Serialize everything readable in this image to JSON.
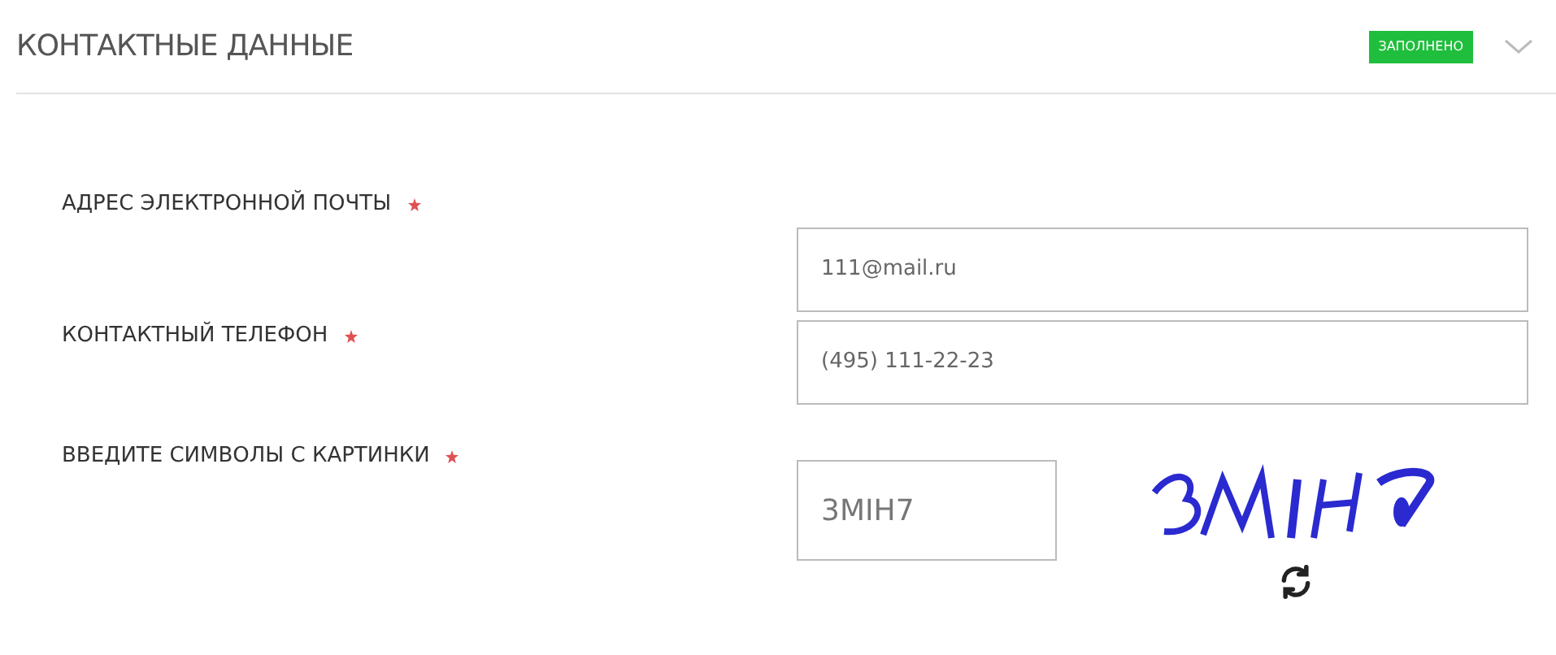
{
  "section": {
    "title": "КОНТАКТНЫЕ ДАННЫЕ",
    "badge": "ЗАПОЛНЕНО",
    "expanded": true
  },
  "fields": [
    {
      "kind": "text",
      "label": "АДРЕС ЭЛЕКТРОННОЙ ПОЧТЫ",
      "required": true,
      "value": "111@mail.ru"
    },
    {
      "kind": "text",
      "label": "КОНТАКТНЫЙ ТЕЛЕФОН",
      "required": true,
      "value": "(495) 111-22-23"
    },
    {
      "kind": "captcha",
      "label": "ВВЕДИТЕ СИМВОЛЫ С КАРТИНКИ",
      "required": true,
      "value": "3MIH7"
    }
  ]
}
